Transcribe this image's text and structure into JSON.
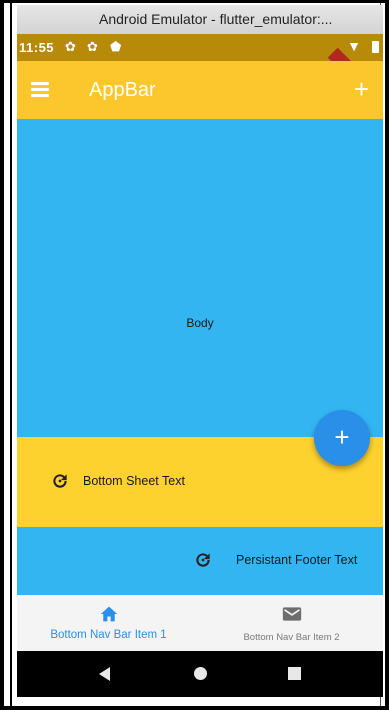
{
  "window": {
    "title": "Android Emulator - flutter_emulator:..."
  },
  "status_bar": {
    "time": "11:55",
    "debug_banner": "DEBUG"
  },
  "app_bar": {
    "title": "AppBar",
    "menu_icon": "menu-icon",
    "action_icon": "add-icon",
    "action_glyph": "+",
    "color": "#fcc72d"
  },
  "body": {
    "label": "Body",
    "color": "#33b5f2"
  },
  "fab": {
    "glyph": "+",
    "icon": "add-icon",
    "color": "#2a8fe8"
  },
  "bottom_sheet": {
    "text": "Bottom Sheet Text",
    "icon": "refresh-icon",
    "color": "#fdd22e"
  },
  "persistent_footer": {
    "text": "Persistant Footer Text",
    "icon": "refresh-icon"
  },
  "bottom_nav": {
    "items": [
      {
        "label": "Bottom Nav Bar Item 1",
        "icon": "home-icon",
        "selected": true
      },
      {
        "label": "Bottom Nav Bar Item 2",
        "icon": "mail-icon",
        "selected": false
      }
    ],
    "selected_color": "#2a8fe8"
  },
  "system_nav": {
    "buttons": [
      "back-icon",
      "home-circle-icon",
      "recent-apps-icon"
    ]
  }
}
